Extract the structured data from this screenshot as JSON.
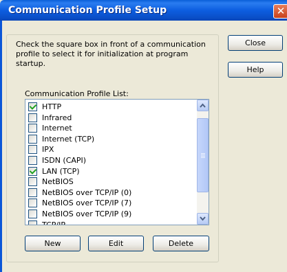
{
  "window": {
    "title": "Communication Profile Setup",
    "close_glyph": "✕"
  },
  "instructions": "Check the square box in front of a communication profile to select it for initialization at program startup.",
  "list_label": "Communication Profile List:",
  "profiles": [
    {
      "label": "HTTP",
      "checked": true
    },
    {
      "label": "Infrared",
      "checked": false
    },
    {
      "label": "Internet",
      "checked": false
    },
    {
      "label": "Internet (TCP)",
      "checked": false
    },
    {
      "label": "IPX",
      "checked": false
    },
    {
      "label": "ISDN (CAPI)",
      "checked": false
    },
    {
      "label": "LAN (TCP)",
      "checked": true
    },
    {
      "label": "NetBIOS",
      "checked": false
    },
    {
      "label": "NetBIOS over TCP/IP (0)",
      "checked": false
    },
    {
      "label": "NetBIOS over TCP/IP (7)",
      "checked": false
    },
    {
      "label": "NetBIOS over TCP/IP (9)",
      "checked": false
    },
    {
      "label": "TCP/IP",
      "checked": false
    }
  ],
  "buttons": {
    "close": "Close",
    "help": "Help",
    "new": "New",
    "edit": "Edit",
    "delete": "Delete"
  },
  "icons": {
    "close": "close-icon",
    "scroll_up": "chevron-up-icon",
    "scroll_down": "chevron-down-icon",
    "check": "checkmark-icon"
  },
  "colors": {
    "titlebar": "#0a5fd8",
    "dialog_bg": "#ece9d8",
    "checkmark": "#21a121",
    "close_button": "#c8411c"
  }
}
